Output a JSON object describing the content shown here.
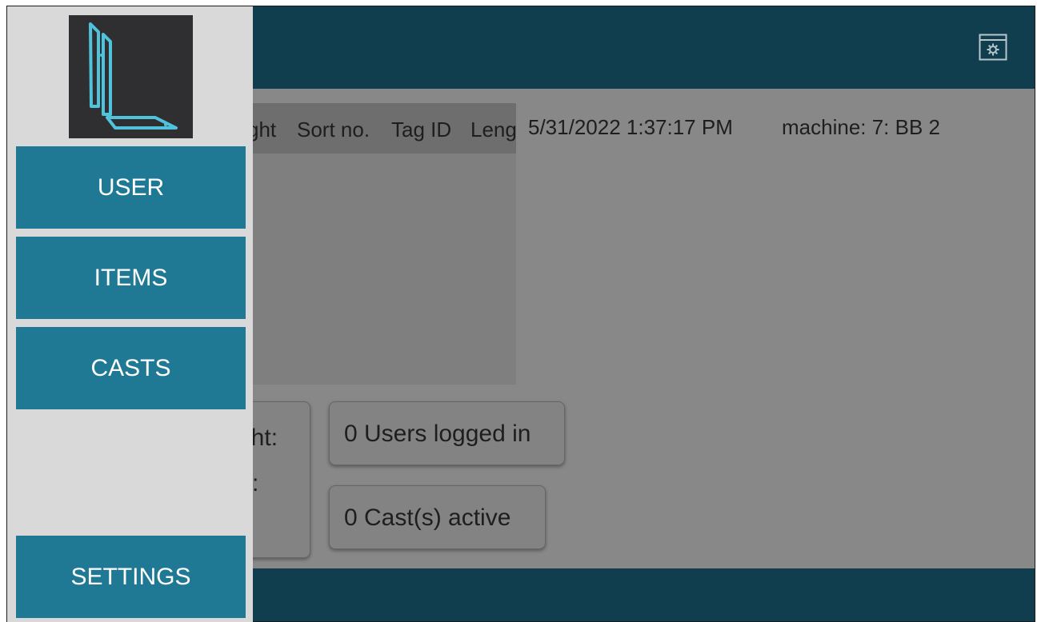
{
  "table": {
    "columns": [
      "ght",
      "Sort no.",
      "Tag ID",
      "Leng"
    ]
  },
  "status": {
    "datetime": "5/31/2022 1:37:17 PM",
    "machine": "machine: 7: BB 2"
  },
  "cards": {
    "weight_label_partial": "ght:",
    "weight_value_partial": ":",
    "users_logged_in": "0 Users logged in",
    "casts_active": "0 Cast(s) active"
  },
  "drawer": {
    "items": [
      {
        "label": "USER"
      },
      {
        "label": "ITEMS"
      },
      {
        "label": "CASTS"
      }
    ],
    "settings_label": "SETTINGS"
  },
  "colors": {
    "header": "#103e4f",
    "nav_button": "#1f7994",
    "drawer_bg": "#d9d9d9",
    "logo_accent": "#4fc3dc",
    "overlay": "#888888"
  },
  "icons": {
    "header_action": "settings-window-icon",
    "logo": "app-logo"
  }
}
